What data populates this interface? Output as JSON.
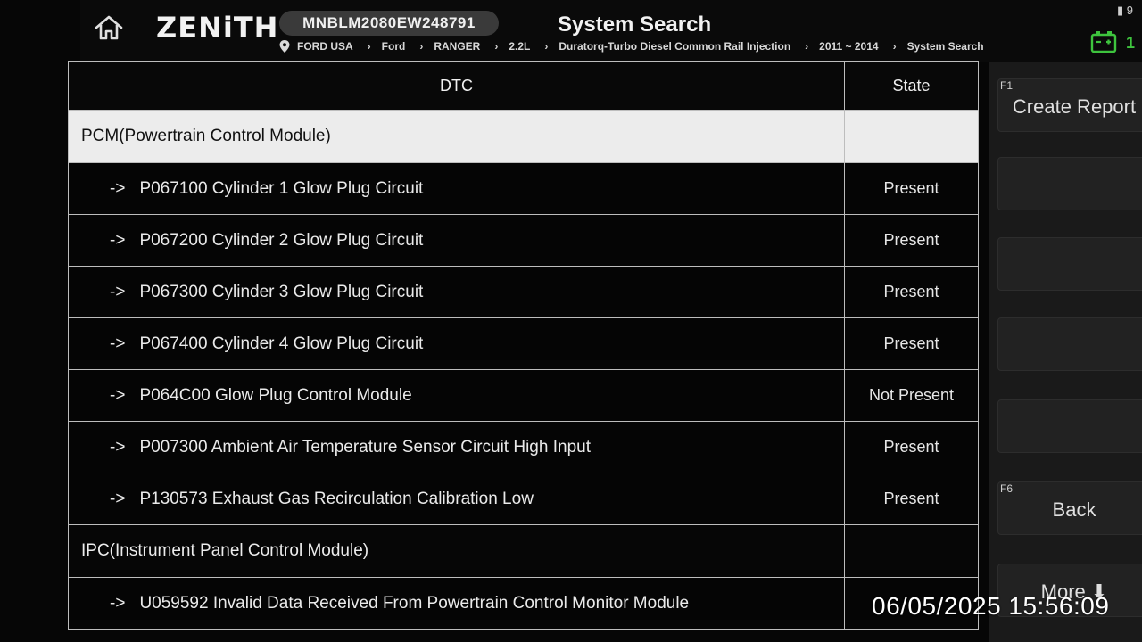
{
  "header": {
    "logo": "ZENiTH",
    "vin": "MNBLM2080EW248791",
    "title": "System Search",
    "breadcrumb": [
      "FORD USA",
      "Ford",
      "RANGER",
      "2.2L",
      "Duratorq-Turbo Diesel Common Rail Injection",
      "2011 ~ 2014",
      "System Search"
    ],
    "battery_value": "1",
    "status_icon": "▮ 9"
  },
  "table": {
    "headers": {
      "dtc": "DTC",
      "state": "State"
    },
    "rows": [
      {
        "type": "module",
        "label": "PCM(Powertrain Control Module)",
        "selected": true
      },
      {
        "type": "item",
        "arrow": "->",
        "code": "P067100 Cylinder 1 Glow Plug Circuit",
        "state": "Present"
      },
      {
        "type": "item",
        "arrow": "->",
        "code": "P067200 Cylinder 2 Glow Plug Circuit",
        "state": "Present"
      },
      {
        "type": "item",
        "arrow": "->",
        "code": "P067300 Cylinder 3 Glow Plug Circuit",
        "state": "Present"
      },
      {
        "type": "item",
        "arrow": "->",
        "code": "P067400 Cylinder 4 Glow Plug Circuit",
        "state": "Present"
      },
      {
        "type": "item",
        "arrow": "->",
        "code": "P064C00 Glow Plug Control Module",
        "state": "Not Present"
      },
      {
        "type": "item",
        "arrow": "->",
        "code": "P007300 Ambient Air Temperature Sensor Circuit High Input",
        "state": "Present"
      },
      {
        "type": "item",
        "arrow": "->",
        "code": "P130573 Exhaust Gas Recirculation Calibration Low",
        "state": "Present"
      },
      {
        "type": "module",
        "label": "IPC(Instrument Panel Control Module)",
        "selected": false
      },
      {
        "type": "item",
        "arrow": "->",
        "code": "U059592 Invalid Data Received From Powertrain Control Monitor Module",
        "state": ""
      }
    ]
  },
  "function_keys": [
    {
      "id": "f1",
      "number": "F1",
      "label": "Create Report"
    },
    {
      "id": "f2",
      "number": "",
      "label": ""
    },
    {
      "id": "f3",
      "number": "",
      "label": ""
    },
    {
      "id": "f4",
      "number": "",
      "label": ""
    },
    {
      "id": "f5",
      "number": "",
      "label": ""
    },
    {
      "id": "f6",
      "number": "F6",
      "label": "Back"
    },
    {
      "id": "more",
      "number": "",
      "label": "More ⬇"
    }
  ],
  "timestamp": "06/05/2025 15:56:09",
  "colors": {
    "background": "#060606",
    "selected_row": "#ececec",
    "battery": "#3ec43e",
    "side_panel": "#1a1a1a"
  }
}
